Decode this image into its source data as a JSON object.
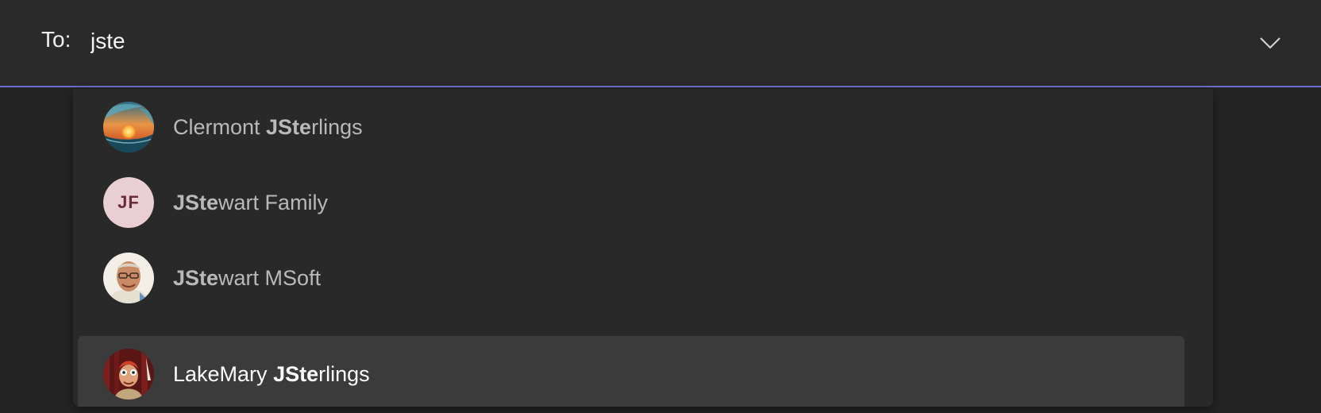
{
  "to_field": {
    "label": "To:",
    "value": "jste"
  },
  "suggestions": [
    {
      "pre": "Clermont ",
      "match": "JSte",
      "post": "rlings",
      "avatar": "photo-sunset-wave"
    },
    {
      "pre": "",
      "match": "JSte",
      "post": "wart Family",
      "avatar": "initials",
      "initials": "JF"
    },
    {
      "pre": "",
      "match": "JSte",
      "post": "wart MSoft",
      "avatar": "photo-man-glasses"
    },
    {
      "pre": "LakeMary ",
      "match": "JSte",
      "post": "rlings",
      "avatar": "photo-red-muppet",
      "selected": true
    }
  ],
  "colors": {
    "accent_underline": "#6f6fd3",
    "background": "#242424",
    "dropdown": "#292929",
    "selected_row": "#3b3b3b",
    "initials_bg": "#e9cfd4",
    "initials_fg": "#6b2b38"
  },
  "icons": {
    "expand": "chevron-down-icon"
  }
}
